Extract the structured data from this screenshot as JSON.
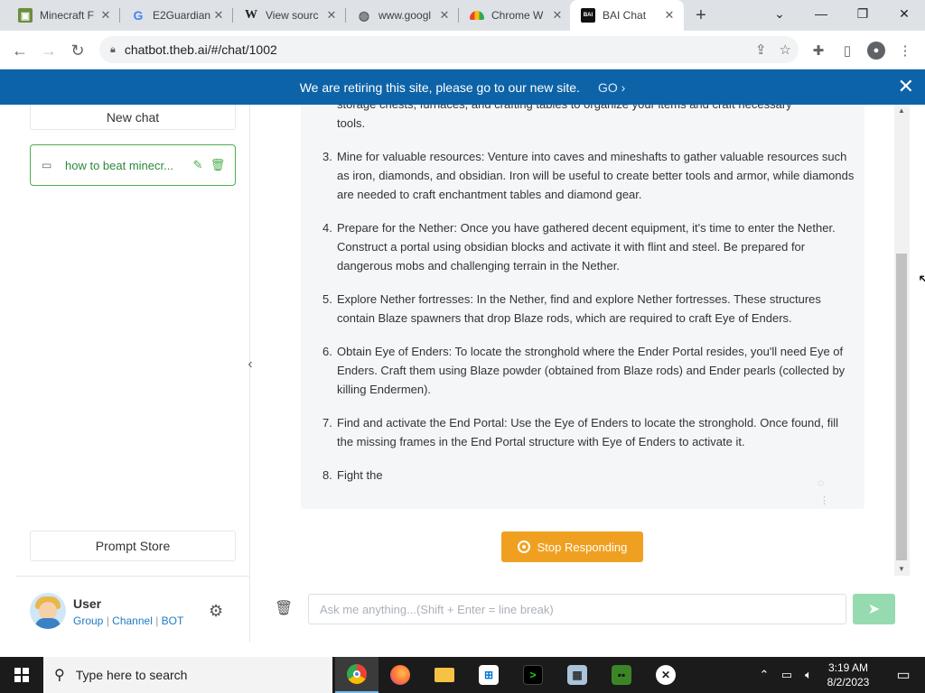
{
  "browser": {
    "tabs": [
      {
        "title": "Minecraft F",
        "favicon": "minecraft-icon"
      },
      {
        "title": "E2Guardian",
        "favicon": "google-icon"
      },
      {
        "title": "View sourc",
        "favicon": "wikipedia-icon"
      },
      {
        "title": "www.googl",
        "favicon": "globe-icon"
      },
      {
        "title": "Chrome W",
        "favicon": "chrome-web-store-icon"
      },
      {
        "title": "BAI Chat",
        "favicon": "bai-icon"
      }
    ],
    "active_tab_index": 5,
    "url": "chatbot.theb.ai/#/chat/1002"
  },
  "banner": {
    "text": "We are retiring this site, please go to our new site.",
    "go_label": "GO"
  },
  "sidebar": {
    "new_chat_label": "New chat",
    "chat_items": [
      {
        "label": "how to beat minecr..."
      }
    ],
    "prompt_store_label": "Prompt Store",
    "user": {
      "name": "User",
      "links": [
        "Group",
        "Channel",
        "BOT"
      ]
    }
  },
  "chat": {
    "partial_top_text": "storage chests, furnaces, and crafting tables to organize your items and craft necessary",
    "partial_top_text_2": "tools.",
    "items": [
      {
        "num": "3.",
        "text": "Mine for valuable resources: Venture into caves and mineshafts to gather valuable resources such as iron, diamonds, and obsidian. Iron will be useful to create better tools and armor, while diamonds are needed to craft enchantment tables and diamond gear."
      },
      {
        "num": "4.",
        "text": "Prepare for the Nether: Once you have gathered decent equipment, it's time to enter the Nether. Construct a portal using obsidian blocks and activate it with flint and steel. Be prepared for dangerous mobs and challenging terrain in the Nether."
      },
      {
        "num": "5.",
        "text": "Explore Nether fortresses: In the Nether, find and explore Nether fortresses. These structures contain Blaze spawners that drop Blaze rods, which are required to craft Eye of Enders."
      },
      {
        "num": "6.",
        "text": "Obtain Eye of Enders: To locate the stronghold where the Ender Portal resides, you'll need Eye of Enders. Craft them using Blaze powder (obtained from Blaze rods) and Ender pearls (collected by killing Endermen)."
      },
      {
        "num": "7.",
        "text": "Find and activate the End Portal: Use the Eye of Enders to locate the stronghold. Once found, fill the missing frames in the End Portal structure with Eye of Enders to activate it."
      },
      {
        "num": "8.",
        "text": "Fight the"
      }
    ],
    "stop_label": "Stop Responding",
    "input_placeholder": "Ask me anything...(Shift + Enter = line break)",
    "input_value": ""
  },
  "taskbar": {
    "search_placeholder": "Type here to search",
    "apps": [
      "chrome-icon",
      "firefox-icon",
      "file-explorer-icon",
      "store-icon",
      "terminal-icon",
      "photos-icon",
      "minecraft-icon",
      "xbox-icon"
    ],
    "time": "3:19 AM",
    "date": "8/2/2023"
  },
  "colors": {
    "banner_bg": "#0d63a8",
    "accent_green": "#4caf50",
    "stop_button": "#f0a020",
    "send_button": "#96dbb0"
  }
}
